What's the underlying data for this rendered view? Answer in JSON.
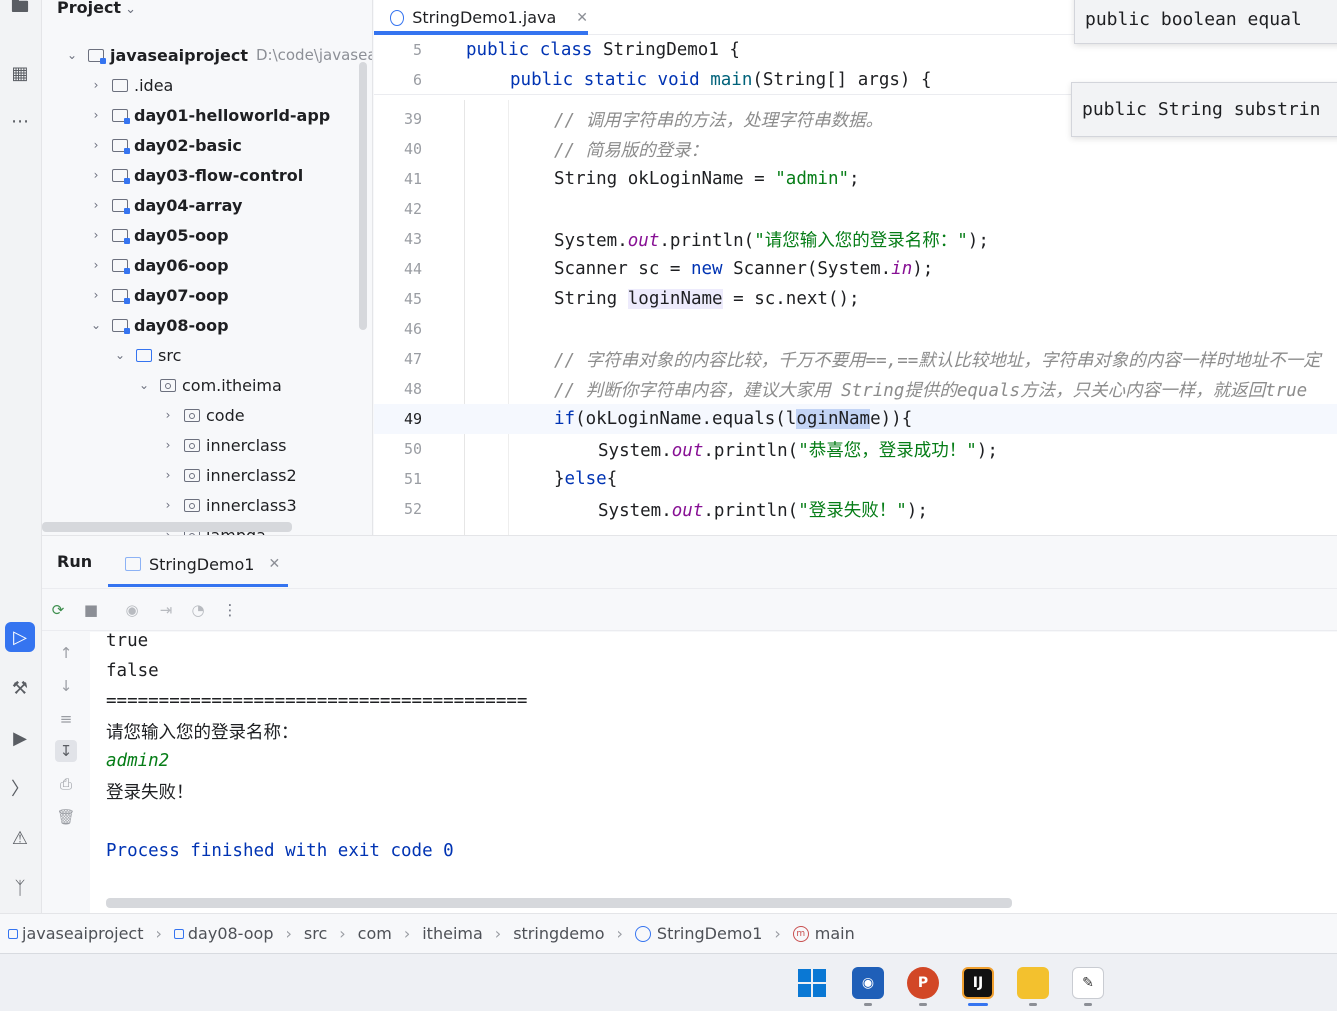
{
  "project_panel": {
    "title": "Project",
    "tree": [
      {
        "label": "javaseaiproject",
        "path": "D:\\code\\javaseaip",
        "bold": true,
        "expanded": true
      },
      {
        "label": ".idea",
        "bold": false,
        "expanded": false
      },
      {
        "label": "day01-helloworld-app",
        "bold": true,
        "expanded": false
      },
      {
        "label": "day02-basic",
        "bold": true,
        "expanded": false
      },
      {
        "label": "day03-flow-control",
        "bold": true,
        "expanded": false
      },
      {
        "label": "day04-array",
        "bold": true,
        "expanded": false
      },
      {
        "label": "day05-oop",
        "bold": true,
        "expanded": false
      },
      {
        "label": "day06-oop",
        "bold": true,
        "expanded": false
      },
      {
        "label": "day07-oop",
        "bold": true,
        "expanded": false
      },
      {
        "label": "day08-oop",
        "bold": true,
        "expanded": true
      },
      {
        "label": "src",
        "bold": false,
        "expanded": true
      },
      {
        "label": "com.itheima",
        "bold": false,
        "expanded": true
      },
      {
        "label": "code",
        "bold": false,
        "expanded": false
      },
      {
        "label": "innerclass",
        "bold": false,
        "expanded": false
      },
      {
        "label": "innerclass2",
        "bold": false,
        "expanded": false
      },
      {
        "label": "innerclass3",
        "bold": false,
        "expanded": false
      },
      {
        "label": "lambda",
        "bold": false,
        "expanded": false
      }
    ]
  },
  "editor": {
    "tab_label": "StringDemo1.java",
    "sticky_lines": [
      {
        "num": "5",
        "code": "public class StringDemo1 {"
      },
      {
        "num": "6",
        "code": "public static void main(String[] args) {"
      }
    ],
    "lines": [
      {
        "num": "39",
        "code": "// 调用字符串的方法，处理字符串数据。"
      },
      {
        "num": "40",
        "code": "// 简易版的登录："
      },
      {
        "num": "41",
        "code": "String okLoginName = \"admin\";"
      },
      {
        "num": "42",
        "code": ""
      },
      {
        "num": "43",
        "code": "System.out.println(\"请您输入您的登录名称：\");"
      },
      {
        "num": "44",
        "code": "Scanner sc = new Scanner(System.in);"
      },
      {
        "num": "45",
        "code": "String loginName = sc.next();"
      },
      {
        "num": "46",
        "code": ""
      },
      {
        "num": "47",
        "code": "// 字符串对象的内容比较，千万不要用==,==默认比较地址，字符串对象的内容一样时地址不一定"
      },
      {
        "num": "48",
        "code": "// 判断你字符串内容，建议大家用 String提供的equals方法，只关心内容一样，就返回true"
      },
      {
        "num": "49",
        "code": "if(okLoginName.equals(loginName)){"
      },
      {
        "num": "50",
        "code": "System.out.println(\"恭喜您，登录成功！\");"
      },
      {
        "num": "51",
        "code": "}else{"
      },
      {
        "num": "52",
        "code": "System.out.println(\"登录失败！\");"
      }
    ],
    "popups": [
      "public boolean equal",
      "public String substrin"
    ]
  },
  "run_panel": {
    "title": "Run",
    "tab_label": "StringDemo1",
    "output": [
      {
        "text": "true",
        "kind": "normal"
      },
      {
        "text": "false",
        "kind": "normal"
      },
      {
        "text": "========================================",
        "kind": "normal"
      },
      {
        "text": "请您输入您的登录名称：",
        "kind": "normal"
      },
      {
        "text": "admin2",
        "kind": "input"
      },
      {
        "text": "登录失败！",
        "kind": "normal"
      },
      {
        "text": "",
        "kind": "normal"
      },
      {
        "text": "Process finished with exit code 0",
        "kind": "process"
      }
    ]
  },
  "breadcrumb": [
    "javaseaiproject",
    "day08-oop",
    "src",
    "com",
    "itheima",
    "stringdemo",
    "StringDemo1",
    "main"
  ],
  "taskbar": {
    "apps": [
      "windows-start",
      "feishu",
      "powerpoint",
      "intellij-idea",
      "file-explorer",
      "notepad"
    ]
  },
  "colors": {
    "accent": "#3574f0",
    "keyword": "#0033b3",
    "string": "#067d17",
    "comment": "#8c8c8c",
    "static_field": "#871094"
  }
}
